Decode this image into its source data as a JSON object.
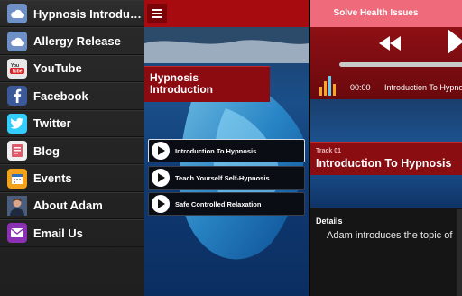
{
  "sidemenu": {
    "items": [
      {
        "label": "Hypnosis Introduct...",
        "icon": "cloud-icon",
        "color": "#6f8fc7"
      },
      {
        "label": "Allergy Release",
        "icon": "cloud-icon",
        "color": "#6f8fc7"
      },
      {
        "label": "YouTube",
        "icon": "youtube-icon",
        "color": "#e8e8e8"
      },
      {
        "label": "Facebook",
        "icon": "facebook-icon",
        "color": "#3b5998"
      },
      {
        "label": "Twitter",
        "icon": "twitter-icon",
        "color": "#33ccff"
      },
      {
        "label": "Blog",
        "icon": "blog-icon",
        "color": "#e05a6a"
      },
      {
        "label": "Events",
        "icon": "calendar-icon",
        "color": "#f3a21b"
      },
      {
        "label": "About Adam",
        "icon": "avatar-icon",
        "color": "#8a6a55"
      },
      {
        "label": "Email Us",
        "icon": "email-icon",
        "color": "#8b2fb3"
      }
    ]
  },
  "topbar": {
    "menu_icon": "hamburger-icon",
    "solve_label": "Solve Health Issues",
    "bar_color": "#a70b10",
    "button_color": "#ef6b7c"
  },
  "playlist": {
    "title": "Hypnosis Introduction",
    "tracks": [
      {
        "name": "Introduction To Hypnosis",
        "selected": true
      },
      {
        "name": "Teach Yourself Self-Hypnosis",
        "selected": false
      },
      {
        "name": "Safe Controlled Relaxation",
        "selected": false
      }
    ]
  },
  "player": {
    "rewind_icon": "rewind-icon",
    "play_icon": "play-icon",
    "equalizer_icon": "equalizer-icon",
    "time": "00:00",
    "now_playing": "Introduction To Hypnosis",
    "progress": 0
  },
  "track_info": {
    "track_number": "Track 01",
    "title": "Introduction To Hypnosis",
    "details_heading": "Details",
    "details_text": "Adam introduces the topic of"
  }
}
